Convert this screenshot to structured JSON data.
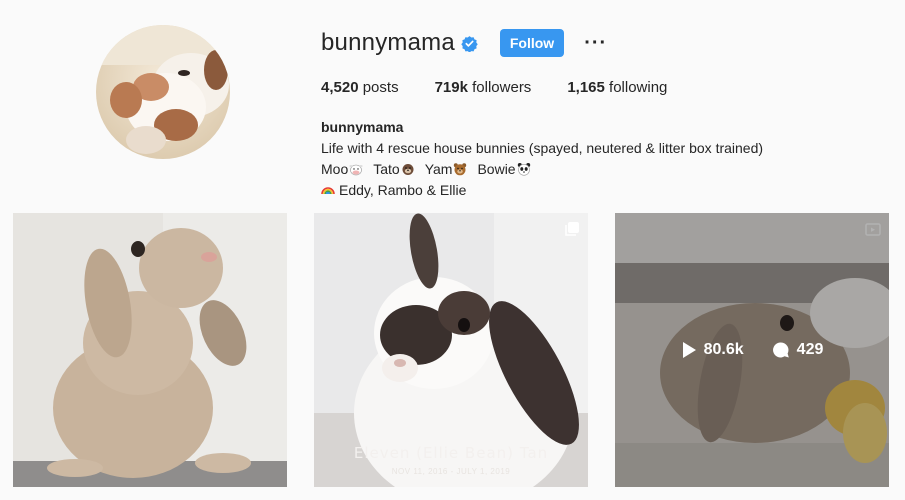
{
  "profile": {
    "username": "bunnymama",
    "verified": true,
    "follow_label": "Follow",
    "more_label": "···",
    "colors": {
      "accent": "#3897f0",
      "verified": "#3897f0"
    }
  },
  "stats": {
    "posts": {
      "count": "4,520",
      "label": "posts"
    },
    "followers": {
      "count": "719k",
      "label": "followers"
    },
    "following": {
      "count": "1,165",
      "label": "following"
    }
  },
  "bio": {
    "name": "bunnymama",
    "line1": "Life with 4 rescue house bunnies (spayed, neutered & litter box trained)",
    "pets": [
      {
        "name": "Moo",
        "icon": "cow-face-icon"
      },
      {
        "name": "Tato",
        "icon": "otter-face-icon"
      },
      {
        "name": "Yam",
        "icon": "bear-face-icon"
      },
      {
        "name": "Bowie",
        "icon": "panda-face-icon"
      }
    ],
    "line3": "Eddy, Rambo & Ellie",
    "line3_icon": "rainbow-icon"
  },
  "posts": [
    {
      "type": "photo"
    },
    {
      "type": "multi-photo",
      "corner_icon": "carousel-icon",
      "caption_main": "Eleven (Ellie Bean) Tan",
      "caption_sub": "NOV 11, 2016 - JULY 1, 2019"
    },
    {
      "type": "video",
      "corner_icon": "video-icon",
      "views": "80.6k",
      "comments": "429",
      "hovered": true
    }
  ]
}
